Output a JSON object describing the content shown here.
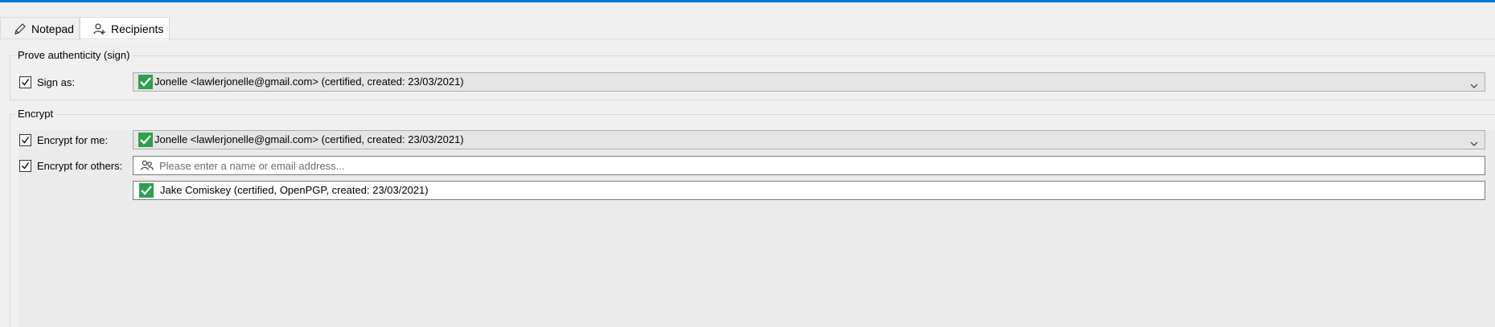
{
  "tabs": [
    {
      "label": "Notepad",
      "icon": "pencil-icon"
    },
    {
      "label": "Recipients",
      "icon": "add-person-icon",
      "active": true
    }
  ],
  "sign_group": {
    "title": "Prove authenticity (sign)",
    "sign_as": {
      "checked": true,
      "label": "Sign as:",
      "value": "Jonelle <lawlerjonelle@gmail.com> (certified,  created: 23/03/2021)"
    }
  },
  "encrypt_group": {
    "title": "Encrypt",
    "encrypt_for_me": {
      "checked": true,
      "label": "Encrypt for me:",
      "value": "Jonelle <lawlerjonelle@gmail.com> (certified,  created: 23/03/2021)"
    },
    "encrypt_for_others": {
      "checked": true,
      "label": "Encrypt for others:",
      "placeholder": "Please enter a name or email address...",
      "value": ""
    },
    "recipients": [
      {
        "text": "Jake Comiskey (certified, OpenPGP, created: 23/03/2021)"
      }
    ]
  },
  "colors": {
    "accent": "#0078d7",
    "certified_green": "#2e9e4f"
  }
}
